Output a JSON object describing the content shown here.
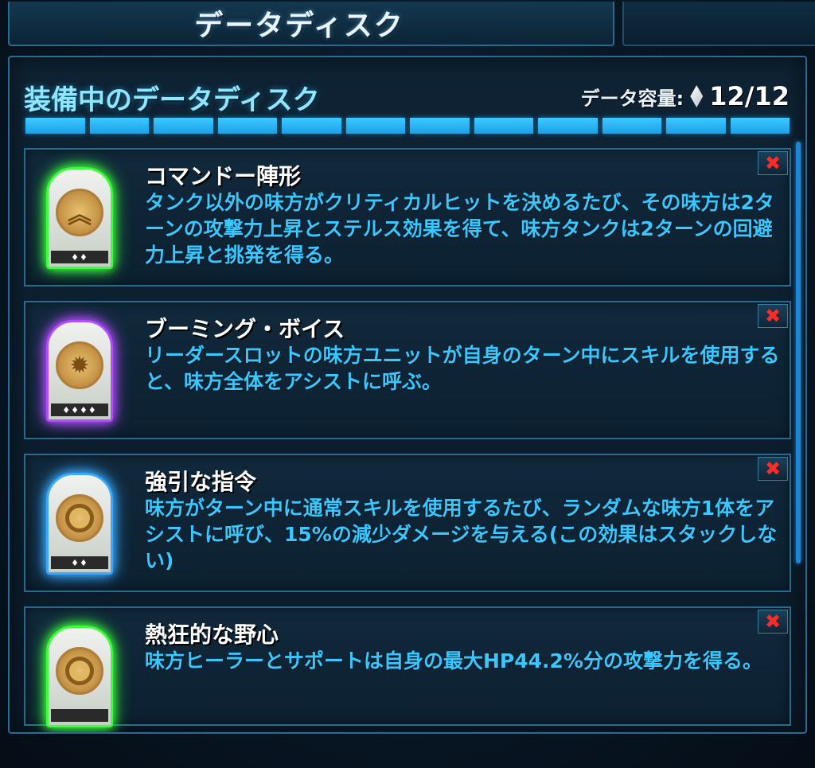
{
  "header": {
    "tab_title": "データディスク"
  },
  "panel": {
    "title": "装備中のデータディスク",
    "capacity_label": "データ容量:",
    "capacity_icon": "diamond-icon",
    "capacity_value": "12/12",
    "capacity_filled_fraction": 1.0
  },
  "colors": {
    "accent": "#39c7ff",
    "green_glow": "#3bff3b",
    "purple_glow": "#b34dff",
    "blue_glow": "#3aa9ff",
    "remove": "#ff2b2b"
  },
  "discs": [
    {
      "name": "コマンドー陣形",
      "desc": "タンク以外の味方がクリティカルヒットを決めるたび、その味方は2ターンの攻撃力上昇とステルス効果を得て、味方タンクは2ターンの回避力上昇と挑発を得る。",
      "rarity": "♦♦",
      "icon": "chevron-rank-icon",
      "remove_label": "✖"
    },
    {
      "name": "ブーミング・ボイス",
      "desc": "リーダースロットの味方ユニットが自身のターン中にスキルを使用すると、味方全体をアシストに呼ぶ。",
      "rarity": "♦♦♦♦",
      "icon": "burst-icon",
      "remove_label": "✖"
    },
    {
      "name": "強引な指令",
      "desc": "味方がターン中に通常スキルを使用するたび、ランダムな味方1体をアシストに呼び、15%の減少ダメージを与える(この効果はスタックしない)",
      "rarity": "♦♦",
      "icon": "ring-icon",
      "remove_label": "✖"
    },
    {
      "name": "熱狂的な野心",
      "desc": "味方ヒーラーとサポートは自身の最大HP44.2%分の攻撃力を得る。",
      "rarity": "",
      "icon": "ring-icon",
      "remove_label": "✖"
    }
  ]
}
